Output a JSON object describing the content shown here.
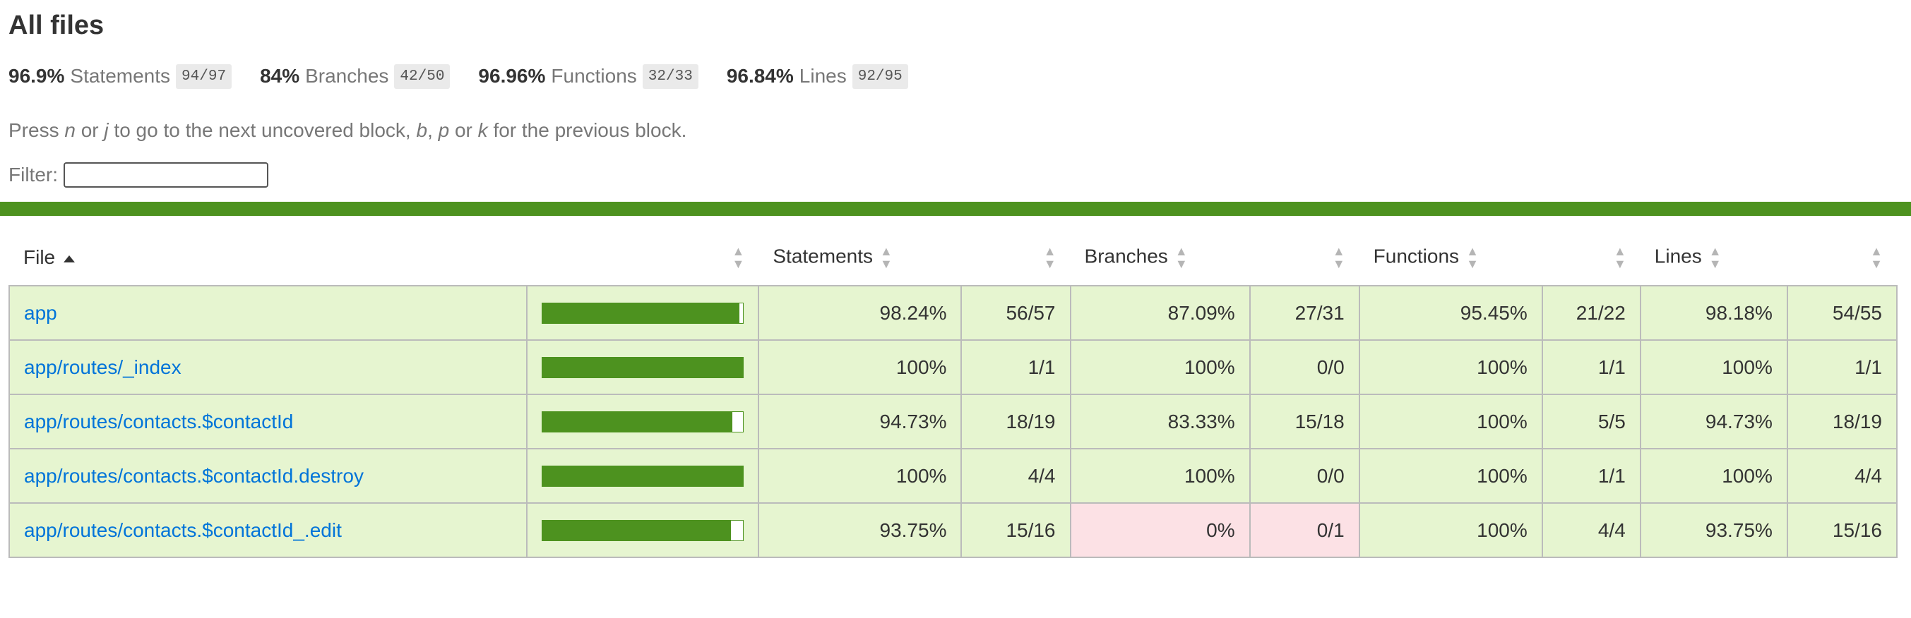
{
  "page": {
    "title": "All files",
    "summary": [
      {
        "pct": "96.9%",
        "label": "Statements",
        "frac": "94/97"
      },
      {
        "pct": "84%",
        "label": "Branches",
        "frac": "42/50"
      },
      {
        "pct": "96.96%",
        "label": "Functions",
        "frac": "32/33"
      },
      {
        "pct": "96.84%",
        "label": "Lines",
        "frac": "92/95"
      }
    ],
    "hint": {
      "t1": "Press ",
      "k1": "n",
      "t2": " or ",
      "k2": "j",
      "t3": " to go to the next uncovered block, ",
      "k3": "b",
      "t4": ", ",
      "k4": "p",
      "t5": " or ",
      "k5": "k",
      "t6": " for the previous block."
    },
    "filter": {
      "label": "Filter:",
      "value": ""
    }
  },
  "table": {
    "headers": {
      "file": "File",
      "statements": "Statements",
      "branches": "Branches",
      "functions": "Functions",
      "lines": "Lines"
    },
    "rows": [
      {
        "file": "app",
        "coverage": 0.9824,
        "stmt_pct": "98.24%",
        "stmt_frac": "56/57",
        "br_pct": "87.09%",
        "br_frac": "27/31",
        "fn_pct": "95.45%",
        "fn_frac": "21/22",
        "ln_pct": "98.18%",
        "ln_frac": "54/55",
        "br_level": "high"
      },
      {
        "file": "app/routes/_index",
        "coverage": 1.0,
        "stmt_pct": "100%",
        "stmt_frac": "1/1",
        "br_pct": "100%",
        "br_frac": "0/0",
        "fn_pct": "100%",
        "fn_frac": "1/1",
        "ln_pct": "100%",
        "ln_frac": "1/1",
        "br_level": "high"
      },
      {
        "file": "app/routes/contacts.$contactId",
        "coverage": 0.9473,
        "stmt_pct": "94.73%",
        "stmt_frac": "18/19",
        "br_pct": "83.33%",
        "br_frac": "15/18",
        "fn_pct": "100%",
        "fn_frac": "5/5",
        "ln_pct": "94.73%",
        "ln_frac": "18/19",
        "br_level": "high"
      },
      {
        "file": "app/routes/contacts.$contactId.destroy",
        "coverage": 1.0,
        "stmt_pct": "100%",
        "stmt_frac": "4/4",
        "br_pct": "100%",
        "br_frac": "0/0",
        "fn_pct": "100%",
        "fn_frac": "1/1",
        "ln_pct": "100%",
        "ln_frac": "4/4",
        "br_level": "high"
      },
      {
        "file": "app/routes/contacts.$contactId_.edit",
        "coverage": 0.9375,
        "stmt_pct": "93.75%",
        "stmt_frac": "15/16",
        "br_pct": "0%",
        "br_frac": "0/1",
        "fn_pct": "100%",
        "fn_frac": "4/4",
        "ln_pct": "93.75%",
        "ln_frac": "15/16",
        "br_level": "low"
      }
    ]
  },
  "colors": {
    "high_bg": "#e6f5d0",
    "low_bg": "#fce1e5",
    "bar": "#4d921f",
    "link": "#0074d9"
  }
}
